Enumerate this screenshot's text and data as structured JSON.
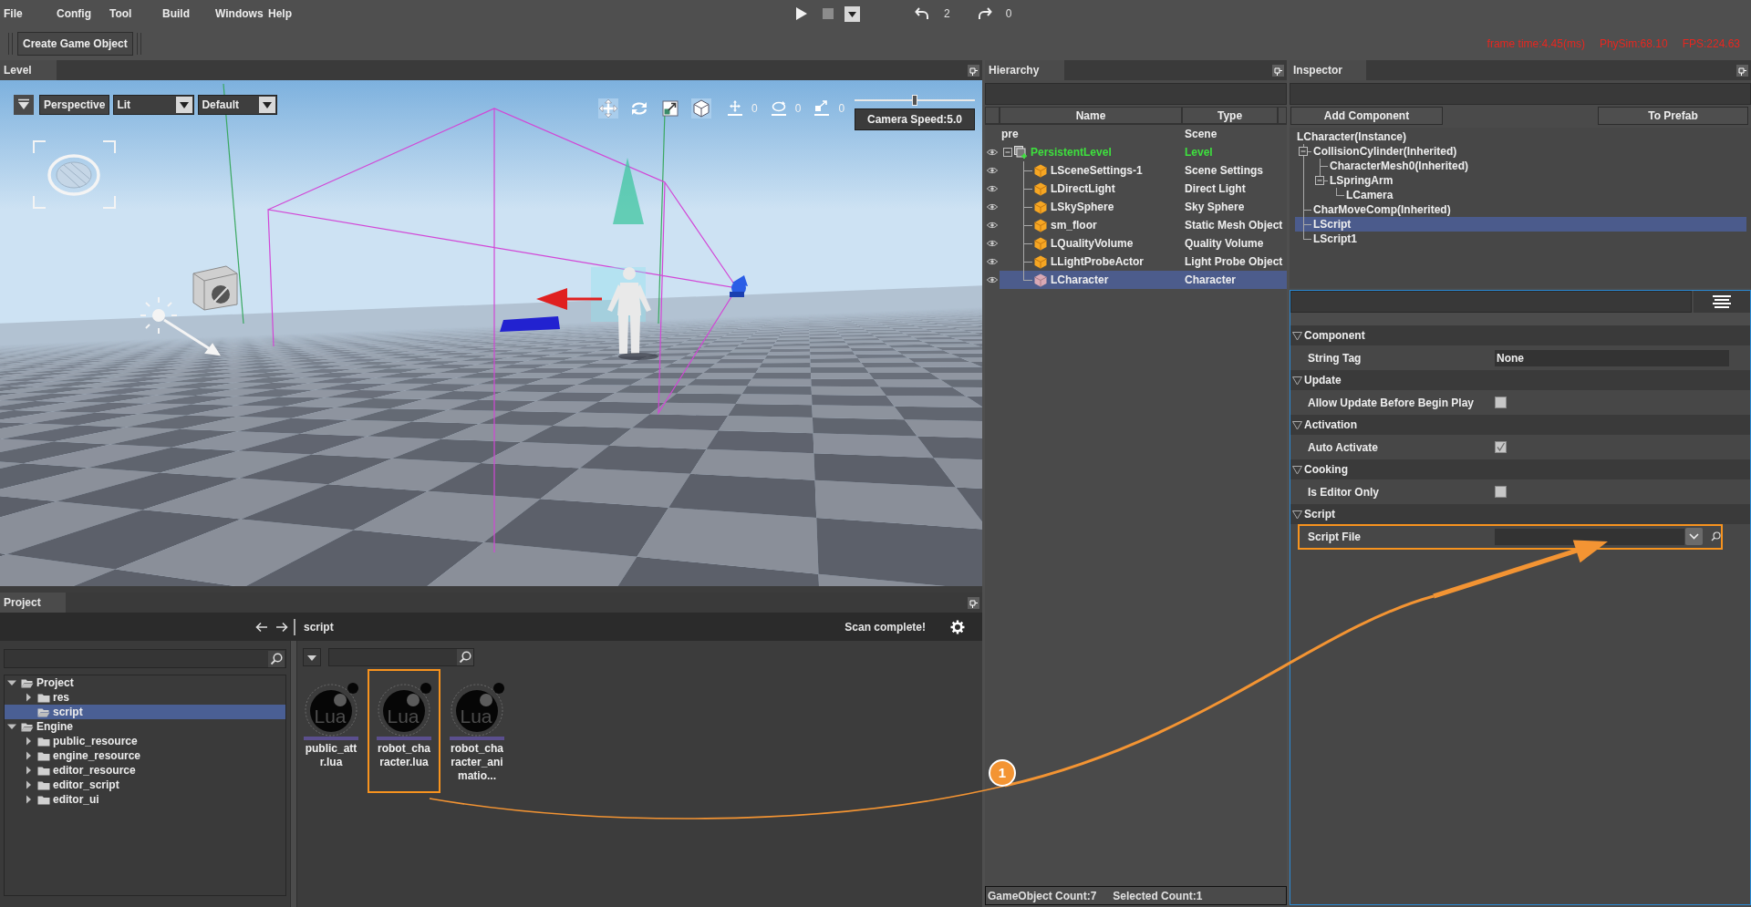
{
  "menu": [
    "File",
    "Config",
    "Tool",
    "Build",
    "Windows",
    "Help"
  ],
  "playback": {
    "stop_disabled": true,
    "undo_count": "2",
    "redo_count": "0"
  },
  "toolbar": {
    "button": "Create Game Object"
  },
  "stats": [
    "frame time:4.45(ms)",
    "PhySim:68.10",
    "FPS:224.63"
  ],
  "level_panel": {
    "title": "Level",
    "view_mode": "Perspective",
    "lighting": "Lit",
    "preset": "Default",
    "transform_tools": [
      {
        "kind": "move",
        "selected": true
      },
      {
        "kind": "rotate",
        "selected": false
      },
      {
        "kind": "scale",
        "selected": false
      }
    ],
    "local_space": {
      "on": true
    },
    "snap_tools": [
      {
        "kind": "move",
        "value": "0"
      },
      {
        "kind": "rotate",
        "value": "0"
      },
      {
        "kind": "scale",
        "value": "0"
      }
    ],
    "camera_speed": {
      "level": 0.5,
      "label": "Camera Speed:5.0"
    }
  },
  "project_panel": {
    "title": "Project",
    "path": "script",
    "scan_status": "Scan complete!",
    "tree": [
      {
        "name": "Project",
        "expanded": true,
        "selected": false,
        "children": [
          {
            "name": "res",
            "expanded": false,
            "selected": false
          },
          {
            "name": "script",
            "selected": true
          }
        ]
      },
      {
        "name": "Engine",
        "expanded": true,
        "selected": false,
        "children": [
          {
            "name": "public_resource",
            "expanded": false,
            "selected": false
          },
          {
            "name": "engine_resource",
            "expanded": false,
            "selected": false
          },
          {
            "name": "editor_resource",
            "expanded": false,
            "selected": false
          },
          {
            "name": "editor_script",
            "expanded": false,
            "selected": false
          },
          {
            "name": "editor_ui",
            "expanded": false,
            "selected": false
          }
        ]
      }
    ],
    "assets": [
      {
        "name": "public_attr.lua",
        "icon_text": "Lua",
        "highlighted": false
      },
      {
        "name": "robot_character.lua",
        "icon_text": "Lua",
        "highlighted": true
      },
      {
        "name": "robot_character_animatio...",
        "icon_text": "Lua",
        "highlighted": false
      }
    ]
  },
  "hierarchy": {
    "title": "Hierarchy",
    "columns": [
      "Name",
      "Type"
    ],
    "tree": [
      {
        "name": "pre",
        "type": "Scene",
        "kind": "scene",
        "visible": false,
        "selected": false,
        "children": [
          {
            "name": "PersistentLevel",
            "type": "Level",
            "kind": "level",
            "visible": true,
            "selected": false,
            "expanded": true,
            "children": [
              {
                "name": "LSceneSettings-1",
                "type": "Scene Settings",
                "kind": "actor",
                "visible": true,
                "selected": false
              },
              {
                "name": "LDirectLight",
                "type": "Direct Light",
                "kind": "actor",
                "visible": true,
                "selected": false
              },
              {
                "name": "LSkySphere",
                "type": "Sky Sphere",
                "kind": "actor",
                "visible": true,
                "selected": false
              },
              {
                "name": "sm_floor",
                "type": "Static Mesh Object",
                "kind": "actor",
                "visible": true,
                "selected": false
              },
              {
                "name": "LQualityVolume",
                "type": "Quality Volume",
                "kind": "actor",
                "visible": true,
                "selected": false
              },
              {
                "name": "LLightProbeActor",
                "type": "Light Probe Object",
                "kind": "actor",
                "visible": true,
                "selected": false
              },
              {
                "name": "LCharacter",
                "type": "Character",
                "kind": "character",
                "visible": true,
                "selected": true
              }
            ]
          }
        ]
      }
    ],
    "status": [
      "GameObject Count:7",
      "Selected Count:1"
    ]
  },
  "inspector": {
    "title": "Inspector",
    "buttons": [
      "Add Component",
      "To Prefab"
    ],
    "components": [
      {
        "name": "LCharacter(Instance)",
        "selected": false,
        "children": [
          {
            "name": "CollisionCylinder(Inherited)",
            "selected": false,
            "expanded": true,
            "children": [
              {
                "name": "CharacterMesh0(Inherited)",
                "selected": false
              },
              {
                "name": "LSpringArm",
                "selected": false,
                "expanded": true,
                "children": [
                  {
                    "name": "LCamera",
                    "selected": false
                  }
                ]
              }
            ]
          },
          {
            "name": "CharMoveComp(Inherited)",
            "selected": false
          },
          {
            "name": "LScript",
            "selected": true
          },
          {
            "name": "LScript1",
            "selected": false
          }
        ]
      }
    ],
    "sections": [
      {
        "title": "Component",
        "expanded": true,
        "properties": [
          {
            "label": "String Tag",
            "kind": "text",
            "value": "None",
            "highlighted": false
          }
        ]
      },
      {
        "title": "Update",
        "expanded": true,
        "properties": [
          {
            "label": "Allow Update Before Begin Play",
            "kind": "checkbox",
            "checked": false,
            "highlighted": false
          }
        ]
      },
      {
        "title": "Activation",
        "expanded": true,
        "properties": [
          {
            "label": "Auto Activate",
            "kind": "checkbox",
            "checked": true,
            "highlighted": false
          }
        ]
      },
      {
        "title": "Cooking",
        "expanded": true,
        "properties": [
          {
            "label": "Is Editor Only",
            "kind": "checkbox",
            "checked": false,
            "highlighted": false
          }
        ]
      },
      {
        "title": "Script",
        "expanded": true,
        "properties": [
          {
            "label": "Script File",
            "kind": "asset",
            "highlighted": true
          }
        ]
      }
    ]
  },
  "callout": {
    "badge": "1"
  }
}
